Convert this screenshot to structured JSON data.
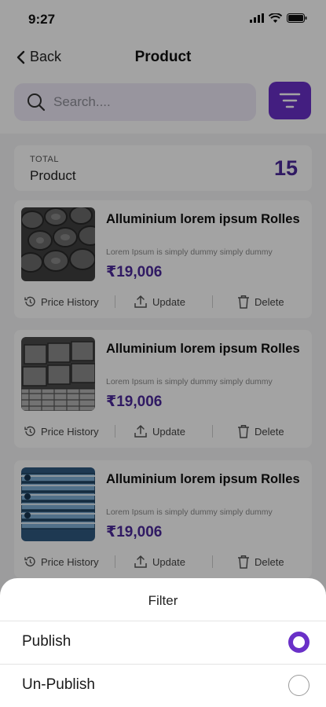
{
  "status": {
    "time": "9:27"
  },
  "header": {
    "back_label": "Back",
    "title": "Product"
  },
  "search": {
    "placeholder": "Search...."
  },
  "total": {
    "label": "TOTAL",
    "text": "Product",
    "count": "15"
  },
  "products": [
    {
      "name": "Alluminium lorem ipsum Rolles",
      "desc": "Lorem Ipsum is simply dummy simply dummy",
      "price": "₹19,006"
    },
    {
      "name": "Alluminium lorem ipsum Rolles",
      "desc": "Lorem Ipsum is simply dummy simply dummy",
      "price": "₹19,006"
    },
    {
      "name": "Alluminium lorem ipsum Rolles",
      "desc": "Lorem Ipsum is simply dummy simply dummy",
      "price": "₹19,006"
    }
  ],
  "actions": {
    "price_history": "Price History",
    "update": "Update",
    "delete": "Delete"
  },
  "filter_sheet": {
    "title": "Filter",
    "options": [
      {
        "label": "Publish",
        "selected": true
      },
      {
        "label": "Un-Publish",
        "selected": false
      }
    ]
  },
  "colors": {
    "accent": "#6a30c8",
    "price": "#4c2a9c",
    "search_bg": "#eeeaf8"
  }
}
